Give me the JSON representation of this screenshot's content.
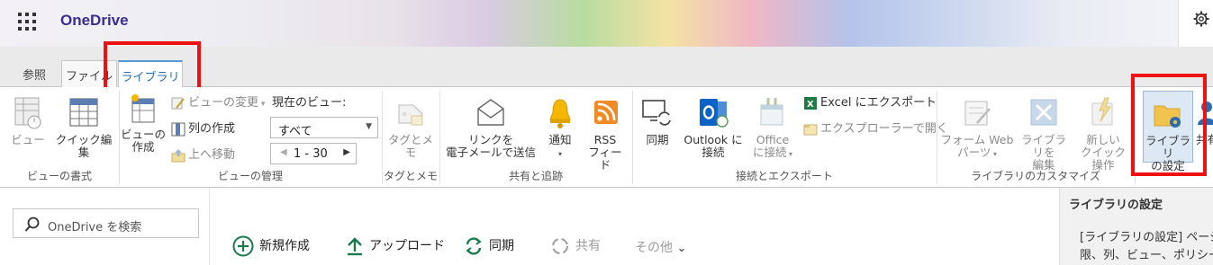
{
  "app": {
    "title": "OneDrive"
  },
  "tabs": {
    "browse": "参照",
    "file": "ファイル",
    "library": "ライブラリ"
  },
  "ribbon": {
    "view_format": {
      "group_label": "ビューの書式",
      "view": "ビュー",
      "quick_edit": "クイック編集"
    },
    "view_manage": {
      "group_label": "ビューの管理",
      "create_view_line1": "ビューの",
      "create_view_line2": "作成",
      "modify_view": "ビューの変更",
      "create_column": "列の作成",
      "navigate_up": "上へ移動",
      "current_view_label": "現在のビュー:",
      "current_view_value": "すべて",
      "paging": "1 - 30"
    },
    "tags": {
      "group_label": "タグとメモ",
      "tags_notes": "タグとメモ"
    },
    "share_track": {
      "group_label": "共有と追跡",
      "email_link_line1": "リンクを",
      "email_link_line2": "電子メールで送信",
      "alert": "通知",
      "rss_line1": "RSS",
      "rss_line2": "フィード"
    },
    "connect_export": {
      "group_label": "接続とエクスポート",
      "sync": "同期",
      "outlook_line1": "Outlook に",
      "outlook_line2": "接続",
      "office_line1": "Office",
      "office_line2": "に接続",
      "excel_export": "Excel にエクスポート",
      "open_explorer": "エクスプローラーで開く"
    },
    "customize": {
      "group_label": "ライブラリのカスタマイズ",
      "form_web_line1": "フォーム Web",
      "form_web_line2": "パーツ",
      "edit_library_line1": "ライブラリを",
      "edit_library_line2": "編集",
      "new_quick_line1": "新しい",
      "new_quick_line2": "クイック操作",
      "library_settings_line1": "ライブラリ",
      "library_settings_line2": "の設定",
      "shared_truncated": "共有"
    }
  },
  "search": {
    "placeholder": "OneDrive を検索"
  },
  "commands": {
    "new": "新規作成",
    "upload": "アップロード",
    "sync": "同期",
    "share": "共有",
    "more": "その他"
  },
  "right_panel": {
    "title": "ライブラリの設定",
    "line1": "[ライブラリの設定] ページ",
    "line2": "限、列、ビュー、ポリシーな"
  },
  "colors": {
    "accent": "#2b6cb0",
    "brand": "#3b2d8f",
    "highlight": "#ee1111",
    "green": "#1a7a4c"
  }
}
